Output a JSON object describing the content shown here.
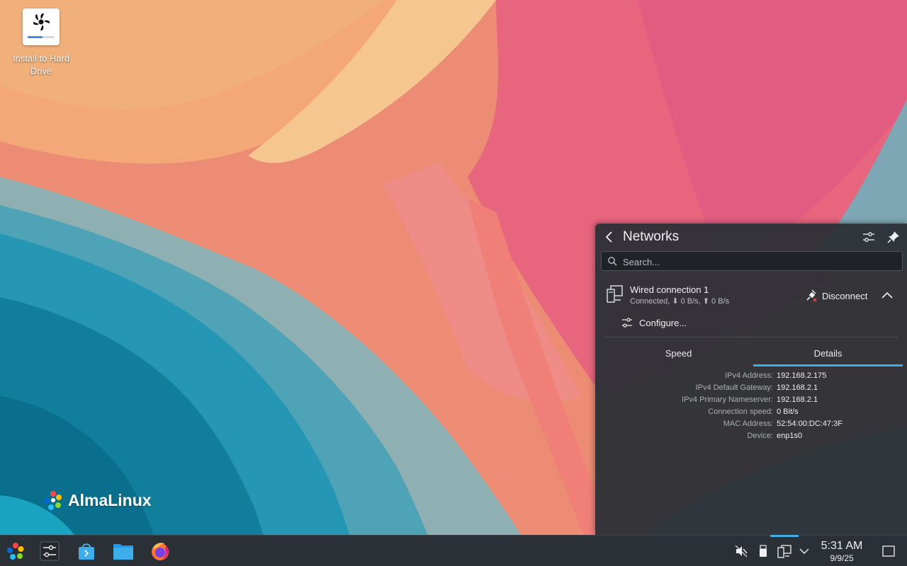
{
  "desktop": {
    "install_icon_label": "Install to Hard Drive",
    "brand_text": "AlmaLinux"
  },
  "networks_popup": {
    "title": "Networks",
    "search_placeholder": "Search...",
    "connection": {
      "name": "Wired connection 1",
      "status": "Connected, ⬇ 0 B/s, ⬆ 0 B/s",
      "disconnect_label": "Disconnect",
      "configure_label": "Configure..."
    },
    "tabs": [
      {
        "label": "Speed",
        "active": false
      },
      {
        "label": "Details",
        "active": true
      }
    ],
    "details": [
      {
        "key": "IPv4 Address:",
        "value": "192.168.2.175"
      },
      {
        "key": "IPv4 Default Gateway:",
        "value": "192.168.2.1"
      },
      {
        "key": "IPv4 Primary Nameserver:",
        "value": "192.168.2.1"
      },
      {
        "key": "Connection speed:",
        "value": "0 Bit/s"
      },
      {
        "key": "MAC Address:",
        "value": "52:54:00:DC:47:3F"
      },
      {
        "key": "Device:",
        "value": "enp1s0"
      }
    ]
  },
  "taskbar": {
    "launchers": [
      "almalinux-logo-icon",
      "system-settings-icon",
      "discover-store-icon",
      "dolphin-folder-icon",
      "firefox-icon"
    ],
    "tray_icons": [
      "volume-muted-icon",
      "usb-device-icon",
      "network-wired-icon",
      "chevron-up-icon"
    ],
    "time": "5:31 AM",
    "date": "9/9/25"
  },
  "colors": {
    "accent": "#3daee9",
    "panel_bg": "#2b3036",
    "popup_bg": "#2f343a"
  }
}
